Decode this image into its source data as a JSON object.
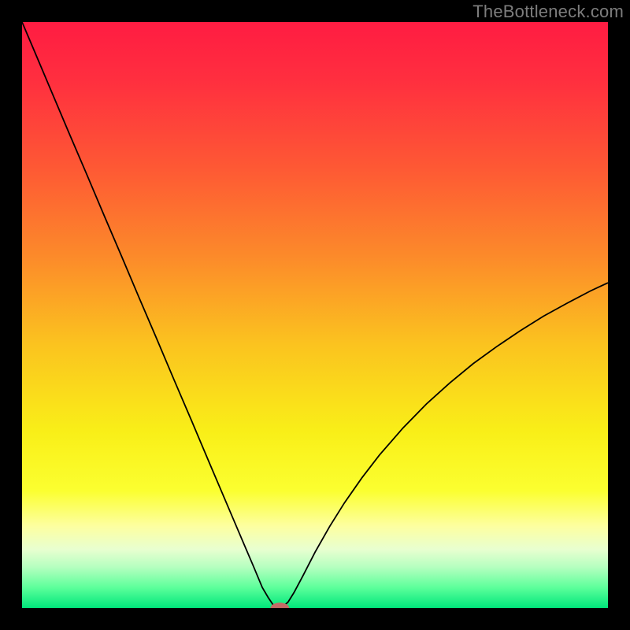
{
  "watermark": "TheBottleneck.com",
  "chart_data": {
    "type": "line",
    "title": "",
    "xlabel": "",
    "ylabel": "",
    "xlim": [
      0,
      100
    ],
    "ylim": [
      0,
      100
    ],
    "background_gradient_stops": [
      {
        "offset": 0.0,
        "color": "#ff1c42"
      },
      {
        "offset": 0.1,
        "color": "#ff2f3f"
      },
      {
        "offset": 0.25,
        "color": "#fe5934"
      },
      {
        "offset": 0.4,
        "color": "#fc8a2a"
      },
      {
        "offset": 0.55,
        "color": "#fbc31f"
      },
      {
        "offset": 0.7,
        "color": "#f9ef18"
      },
      {
        "offset": 0.8,
        "color": "#fbff30"
      },
      {
        "offset": 0.86,
        "color": "#fdffa0"
      },
      {
        "offset": 0.9,
        "color": "#e8ffd0"
      },
      {
        "offset": 0.93,
        "color": "#b6ffc0"
      },
      {
        "offset": 0.965,
        "color": "#5dff9b"
      },
      {
        "offset": 1.0,
        "color": "#00e77b"
      }
    ],
    "series": [
      {
        "name": "bottleneck-curve",
        "color": "#000000",
        "x": [
          0,
          2,
          5,
          8,
          11,
          14,
          17,
          20,
          23,
          26,
          29,
          32,
          34,
          36,
          38,
          39.5,
          41,
          42,
          42.8,
          43.4,
          44,
          44.6,
          45.4,
          46.4,
          48,
          50,
          52.5,
          55,
          58,
          61,
          65,
          69,
          73,
          77,
          81,
          85,
          89,
          93,
          97,
          100
        ],
        "y": [
          100,
          95.3,
          88.2,
          81.1,
          74.1,
          67.0,
          60.0,
          52.9,
          45.9,
          38.8,
          31.8,
          24.7,
          20.0,
          15.3,
          10.6,
          7.1,
          3.5,
          1.8,
          0.6,
          0.2,
          0.0,
          0.3,
          1.0,
          2.6,
          5.6,
          9.5,
          13.9,
          17.9,
          22.2,
          26.1,
          30.7,
          34.8,
          38.4,
          41.7,
          44.6,
          47.3,
          49.8,
          52.0,
          54.1,
          55.5
        ]
      }
    ],
    "markers": [
      {
        "name": "optimal-point",
        "x": 44,
        "y": 0,
        "rx": 1.6,
        "ry": 0.9,
        "color": "#c46b66"
      }
    ]
  }
}
